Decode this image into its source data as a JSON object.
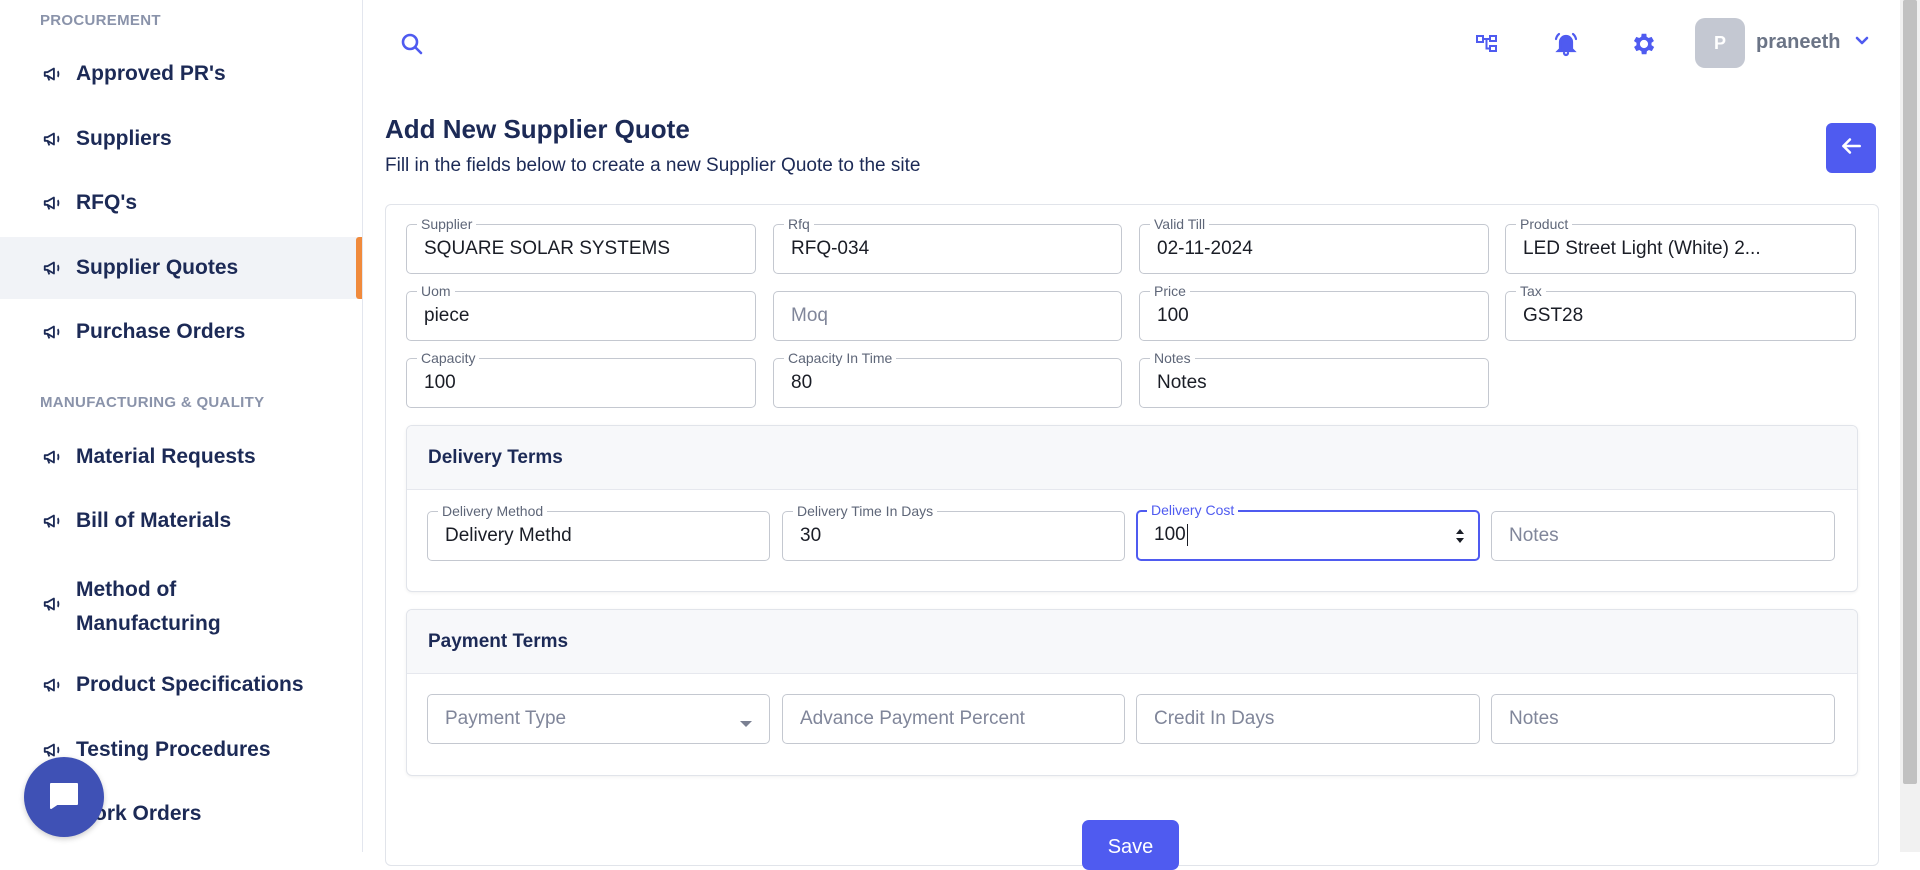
{
  "sidebar": {
    "sections": [
      {
        "title": "PROCUREMENT"
      },
      {
        "title": "MANUFACTURING & QUALITY"
      }
    ],
    "items": [
      {
        "label": "Approved PR's"
      },
      {
        "label": "Suppliers"
      },
      {
        "label": "RFQ's"
      },
      {
        "label": "Supplier Quotes",
        "active": true
      },
      {
        "label": "Purchase Orders"
      },
      {
        "label": "Material Requests"
      },
      {
        "label": "Bill of Materials"
      },
      {
        "label": "Method of"
      },
      {
        "label": "Manufacturing"
      },
      {
        "label": "Product Specifications"
      },
      {
        "label": "Testing Procedures"
      },
      {
        "label": "ork Orders"
      }
    ]
  },
  "topbar": {
    "avatar_initial": "P",
    "username": "praneeth",
    "icons": [
      "search-icon",
      "hierarchy-icon",
      "bell-icon",
      "gear-icon",
      "chevron-down-icon"
    ]
  },
  "page": {
    "title": "Add New Supplier Quote",
    "subtitle": "Fill in the fields below to create a new Supplier Quote to the site"
  },
  "form": {
    "supplier": {
      "label": "Supplier",
      "value": "SQUARE SOLAR SYSTEMS"
    },
    "rfq": {
      "label": "Rfq",
      "value": "RFQ-034"
    },
    "valid_till": {
      "label": "Valid Till",
      "value": "02-11-2024"
    },
    "product": {
      "label": "Product",
      "value": "LED Street Light (White) 2..."
    },
    "uom": {
      "label": "Uom",
      "value": "piece"
    },
    "moq": {
      "placeholder": "Moq"
    },
    "price": {
      "label": "Price",
      "value": "100"
    },
    "tax": {
      "label": "Tax",
      "value": "GST28"
    },
    "capacity": {
      "label": "Capacity",
      "value": "100"
    },
    "capacity_in_time": {
      "label": "Capacity In Time",
      "value": "80"
    },
    "notes": {
      "label": "Notes",
      "value": "Notes"
    }
  },
  "delivery_terms": {
    "title": "Delivery Terms",
    "method": {
      "label": "Delivery Method",
      "value": "Delivery Methd"
    },
    "time": {
      "label": "Delivery Time In Days",
      "value": "30"
    },
    "cost": {
      "label": "Delivery Cost",
      "value": "100"
    },
    "notes": {
      "placeholder": "Notes"
    }
  },
  "payment_terms": {
    "title": "Payment Terms",
    "type": {
      "placeholder": "Payment Type"
    },
    "advance": {
      "placeholder": "Advance Payment Percent"
    },
    "credit": {
      "placeholder": "Credit In Days"
    },
    "notes": {
      "placeholder": "Notes"
    }
  },
  "actions": {
    "save_label": "Save"
  },
  "colors": {
    "accent": "#4f5bf0",
    "nav_text": "#1c2a56",
    "active_marker": "#f08a3c",
    "chat_bubble": "#3f51b5"
  }
}
